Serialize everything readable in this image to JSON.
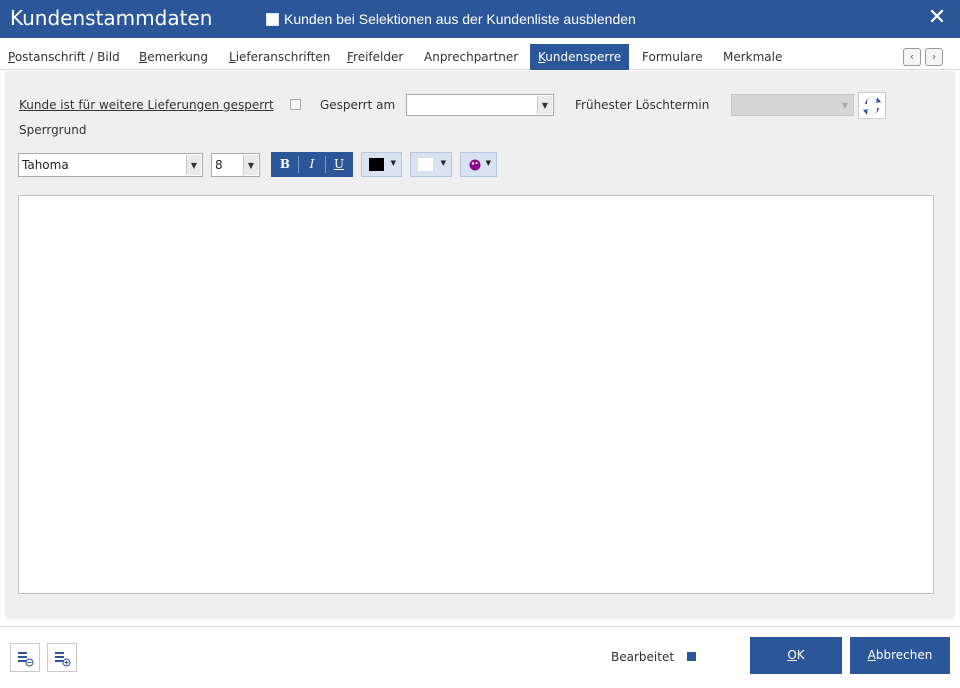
{
  "window": {
    "title": "Kundenstammdaten",
    "hide_checkbox_label": "Kunden bei Selektionen aus der Kundenliste ausblenden",
    "close_glyph": "✕"
  },
  "tabs": [
    {
      "label": "Postanschrift / Bild",
      "active": false
    },
    {
      "label": "Bemerkung",
      "active": false
    },
    {
      "label": "Lieferanschriften",
      "active": false
    },
    {
      "label": "Freifelder",
      "active": false
    },
    {
      "label": "Anprechpartner",
      "active": false
    },
    {
      "label": "Kundensperre",
      "active": true
    },
    {
      "label": "Formulare",
      "active": false
    },
    {
      "label": "Merkmale",
      "active": false
    }
  ],
  "tab_nav": {
    "prev": "‹",
    "next": "›"
  },
  "sperre": {
    "blocked_label": "Kunde ist für weitere Lieferungen gesperrt",
    "blocked_checked": false,
    "gesperrt_am_label": "Gesperrt am",
    "gesperrt_am_value": "",
    "loeschtermin_label": "Frühester Löschtermin",
    "loeschtermin_value": "",
    "sperrgrund_label": "Sperrgrund"
  },
  "toolbar": {
    "font_value": "Tahoma",
    "size_value": "8",
    "bold": "B",
    "italic": "I",
    "underline": "U",
    "text_color": "#000000",
    "back_color": "#ffffff",
    "extra_color": "#8b0a8b"
  },
  "editor": {
    "text": ""
  },
  "footer": {
    "bearbeitet_label": "Bearbeitet",
    "ok_label": "OK",
    "cancel_label": "Abbrechen"
  },
  "colors": {
    "accent": "#2b579a"
  }
}
